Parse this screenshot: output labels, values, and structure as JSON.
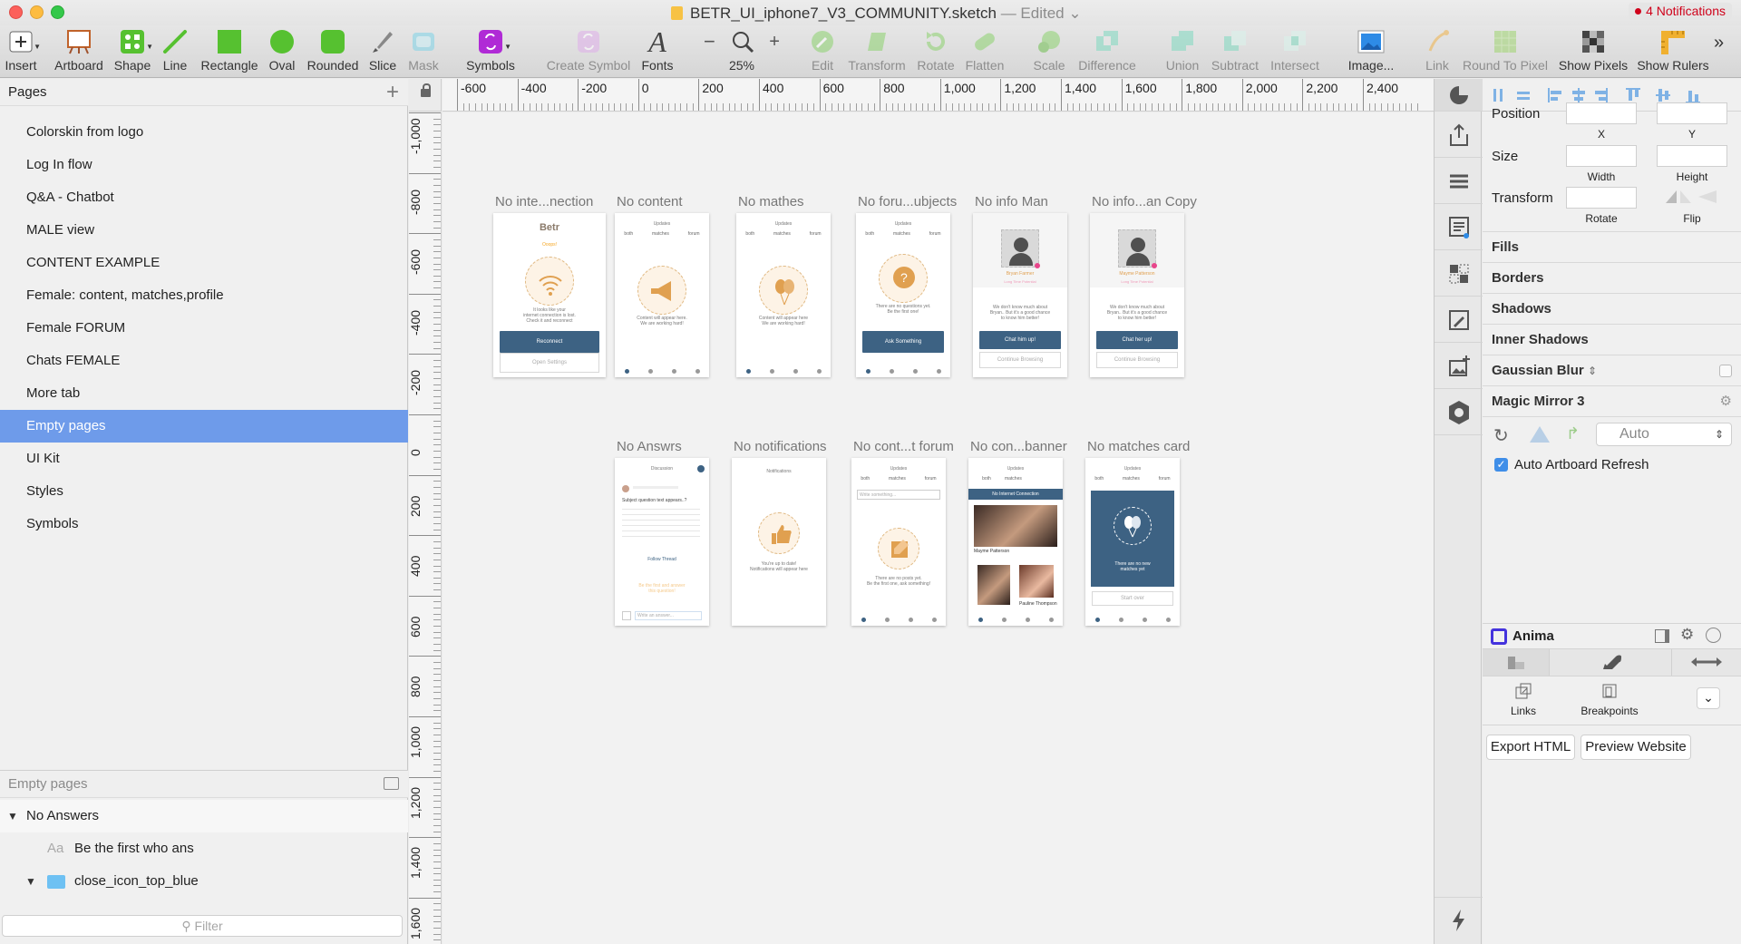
{
  "window": {
    "title": "BETR_UI_iphone7_V3_COMMUNITY.sketch",
    "status": "— Edited",
    "notifications": "4 Notifications"
  },
  "toolbar": {
    "items": [
      {
        "label": "Insert",
        "icon": "plus-icon"
      },
      {
        "label": "Artboard",
        "icon": "artboard-icon"
      },
      {
        "label": "Shape",
        "icon": "shape-icon"
      },
      {
        "label": "Line",
        "icon": "line-icon"
      },
      {
        "label": "Rectangle",
        "icon": "rectangle-icon"
      },
      {
        "label": "Oval",
        "icon": "oval-icon"
      },
      {
        "label": "Rounded",
        "icon": "rounded-rect-icon"
      },
      {
        "label": "Slice",
        "icon": "slice-icon"
      },
      {
        "label": "Mask",
        "icon": "mask-icon"
      },
      {
        "label": "Symbols",
        "icon": "symbols-icon"
      },
      {
        "label": "Create Symbol",
        "icon": "create-symbol-icon"
      },
      {
        "label": "Fonts",
        "icon": "fonts-icon"
      },
      {
        "label": "25%",
        "icon": "zoom-icon"
      },
      {
        "label": "Edit",
        "icon": "edit-icon"
      },
      {
        "label": "Transform",
        "icon": "transform-icon"
      },
      {
        "label": "Rotate",
        "icon": "rotate-icon"
      },
      {
        "label": "Flatten",
        "icon": "flatten-icon"
      },
      {
        "label": "Scale",
        "icon": "scale-icon"
      },
      {
        "label": "Difference",
        "icon": "difference-icon"
      },
      {
        "label": "Union",
        "icon": "union-icon"
      },
      {
        "label": "Subtract",
        "icon": "subtract-icon"
      },
      {
        "label": "Intersect",
        "icon": "intersect-icon"
      },
      {
        "label": "Image...",
        "icon": "image-icon"
      },
      {
        "label": "Link",
        "icon": "link-icon"
      },
      {
        "label": "Round To Pixel",
        "icon": "round-to-pixel-icon"
      },
      {
        "label": "Show Pixels",
        "icon": "show-pixels-icon"
      },
      {
        "label": "Show Rulers",
        "icon": "show-rulers-icon"
      }
    ],
    "zoom_minus": "−",
    "zoom_plus": "+"
  },
  "pages": {
    "header": "Pages",
    "items": [
      "Colorskin from logo",
      "Log In flow",
      "Q&A - Chatbot",
      "MALE view",
      "CONTENT EXAMPLE",
      "Female: content, matches,profile",
      "Female FORUM",
      "Chats FEMALE",
      "More tab",
      "Empty pages",
      "UI Kit",
      "Styles",
      "Symbols"
    ],
    "selected": "Empty pages"
  },
  "layers": {
    "header": "Empty pages",
    "rows": [
      "No Answers",
      "Be the first who ans",
      "close_icon_top_blue"
    ],
    "text_marker": "Aa",
    "filter_placeholder": "Filter"
  },
  "rulers": {
    "horizontal": [
      "-600",
      "-400",
      "-200",
      "0",
      "200",
      "400",
      "600",
      "800",
      "1,000",
      "1,200",
      "1,400",
      "1,600",
      "1,800",
      "2,000",
      "2,200",
      "2,400"
    ],
    "vertical": [
      "-1,000",
      "-800",
      "-600",
      "-400",
      "-200",
      "0",
      "200",
      "400",
      "600",
      "800",
      "1,000",
      "1,200",
      "1,400",
      "1,600"
    ]
  },
  "artboards": [
    {
      "name": "No inte...nection",
      "logo": "Betr",
      "headline": "Ooops!",
      "body1": "It looks like your",
      "body2": "internet connection is lost.",
      "body3": "Check it and reconnect",
      "primary": "Reconnect",
      "secondary": "Open Settings"
    },
    {
      "name": "No content",
      "header": "Updates",
      "tabs": [
        "both",
        "matches",
        "forum"
      ],
      "body1": "Content will appear here.",
      "body2": "We are working hard!"
    },
    {
      "name": "No mathes",
      "header": "Updates",
      "tabs": [
        "both",
        "matches",
        "forum"
      ],
      "body1": "Content will appear here",
      "body2": "We are working hard!"
    },
    {
      "name": "No foru...ubjects",
      "header": "Updates",
      "tabs": [
        "both",
        "matches",
        "forum"
      ],
      "body1": "There are no questions yet.",
      "body2": "Be the first one!",
      "primary": "Ask Something"
    },
    {
      "name": "No info Man",
      "person": "Bryan Farmer",
      "sub": "Long Time Potential",
      "body1": "We don't know much about",
      "body2": "Bryan.. But it's a good chance",
      "body3": "to know him better!",
      "primary": "Chat him up!",
      "secondary": "Continue Browsing"
    },
    {
      "name": "No info...an Copy",
      "person": "Mayme Patterson",
      "sub": "Long Time Potential",
      "body1": "We don't know much about",
      "body2": "Bryan.. But it's a good chance",
      "body3": "to know him better!",
      "primary": "Chat her up!",
      "secondary": "Continue Browsing"
    },
    {
      "name": "No Answrs",
      "header": "Discussion",
      "body1": "Subject question text appears..?",
      "primary": "Follow Thread",
      "cta1": "Be the first and answer",
      "cta2": "this question!",
      "input": "Write an answer..."
    },
    {
      "name": "No notifications",
      "header": "Notifications",
      "body1": "You're up to date!",
      "body2": "Notifications will appear here"
    },
    {
      "name": "No cont...t forum",
      "header": "Updates",
      "tabs": [
        "both",
        "matches",
        "forum"
      ],
      "input": "Write something...",
      "body1": "There are no posts yet.",
      "body2": "Be the first one, ask something!"
    },
    {
      "name": "No con...banner",
      "header": "Updates",
      "tabs": [
        "both",
        "matches"
      ],
      "banner": "No Internet Connection",
      "person1": "Mayme Patterson",
      "person2": "Pauline Thompson"
    },
    {
      "name": "No matches card",
      "header": "Updates",
      "tabs": [
        "both",
        "matches",
        "forum"
      ],
      "body1": "There are no new",
      "body2": "matches yet",
      "secondary": "Start over"
    }
  ],
  "inspector": {
    "position_label": "Position",
    "size_label": "Size",
    "transform_label": "Transform",
    "x_label": "X",
    "y_label": "Y",
    "width_label": "Width",
    "height_label": "Height",
    "rotate_label": "Rotate",
    "flip_label": "Flip",
    "sections": [
      "Fills",
      "Borders",
      "Shadows",
      "Inner Shadows",
      "Gaussian Blur",
      "Magic Mirror 3"
    ],
    "auto_select": "Auto",
    "auto_refresh": "Auto Artboard Refresh",
    "anima_title": "Anima",
    "links_label": "Links",
    "breakpoints_label": "Breakpoints",
    "export_html": "Export HTML",
    "preview_website": "Preview Website"
  },
  "colors": {
    "selection": "#6e9bea",
    "accent_orange": "#f5a623",
    "button_blue": "#3d6283",
    "toolbar_green": "#56c130",
    "symbols_purple": "#b02ad6",
    "notification_red": "#d0021b"
  }
}
